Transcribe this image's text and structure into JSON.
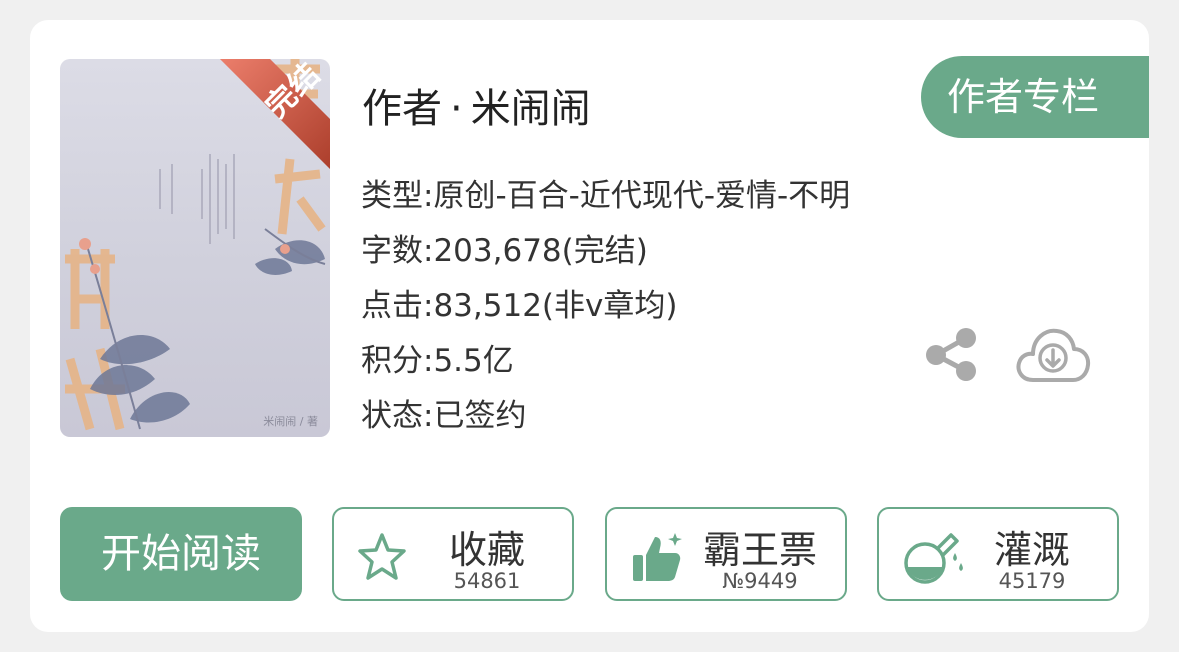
{
  "book": {
    "cover": {
      "badge": "完结",
      "cover_author": "米闹闹 / 著"
    },
    "title_prefix": "作者",
    "title_dot": "·",
    "author": "米闹闹",
    "author_column_button": "作者专栏",
    "info": {
      "type": "类型:原创-百合-近代现代-爱情-不明",
      "words": "字数:203,678(完结)",
      "clicks": "点击:83,512(非v章均)",
      "score": "积分:5.5亿",
      "status": "状态:已签约"
    }
  },
  "actions": {
    "read": "开始阅读",
    "favorite": {
      "label": "收藏",
      "count": "54861"
    },
    "bawang": {
      "label": "霸王票",
      "count": "№9449"
    },
    "irrigate": {
      "label": "灌溉",
      "count": "45179"
    }
  },
  "icons": [
    "share-icon",
    "download-cloud-icon",
    "star-icon",
    "thumbs-up-icon",
    "flask-icon"
  ],
  "colors": {
    "accent": "#6aa98a",
    "badge": "#e5533a",
    "icon_gray": "#aaaaaa"
  }
}
